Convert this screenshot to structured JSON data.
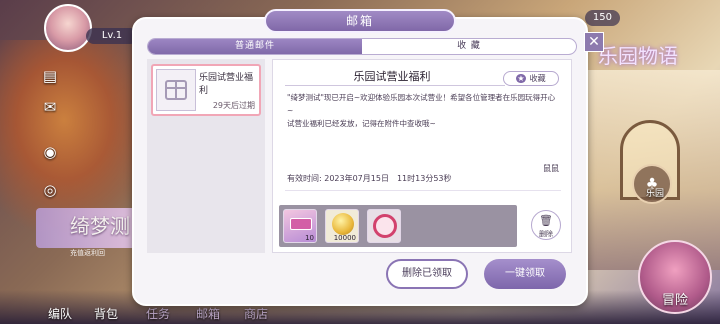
{
  "hud": {
    "level": "Lv.1",
    "currency_right": "150"
  },
  "side_icons": [
    "document-icon",
    "users-icon",
    "camera-icon"
  ],
  "banner_left": {
    "title": "绮梦测",
    "subtitle": "充值返利回"
  },
  "logo_right": {
    "title": "乐园物语",
    "subtitle": ""
  },
  "world_button": {
    "label": "乐园"
  },
  "adventure_button": {
    "label": "冒险"
  },
  "bottom_nav": [
    {
      "label": "编队"
    },
    {
      "label": "背包"
    },
    {
      "label": "任务"
    },
    {
      "label": "邮箱"
    },
    {
      "label": "商店"
    }
  ],
  "modal": {
    "title": "邮箱",
    "close_icon": "close-icon",
    "tabs": [
      {
        "label": "普通邮件",
        "active": true
      },
      {
        "label": "收 藏",
        "active": false
      }
    ],
    "mail_list": [
      {
        "title": "乐园试营业福利",
        "expire": "29天后过期",
        "selected": true
      }
    ],
    "detail": {
      "title": "乐园试营业福利",
      "favorite_label": "收藏",
      "body_line1": "\"绮梦测试\"现已开启~欢迎体验乐园本次试营业！希望各位管理者在乐园玩得开心~",
      "body_line2": "试营业福利已经发放，记得在附件中查收哦~",
      "sign": "鼠鼠",
      "valid_time": "有效时间: 2023年07月15日　11时13分53秒",
      "rewards": [
        {
          "icon": "ticket-icon",
          "count": "10"
        },
        {
          "icon": "coin-icon",
          "count": "10000"
        },
        {
          "icon": "emblem-icon",
          "count": ""
        }
      ],
      "delete_label": "删除"
    },
    "buttons": {
      "delete_received": "删除已领取",
      "claim_all": "一键领取"
    }
  }
}
